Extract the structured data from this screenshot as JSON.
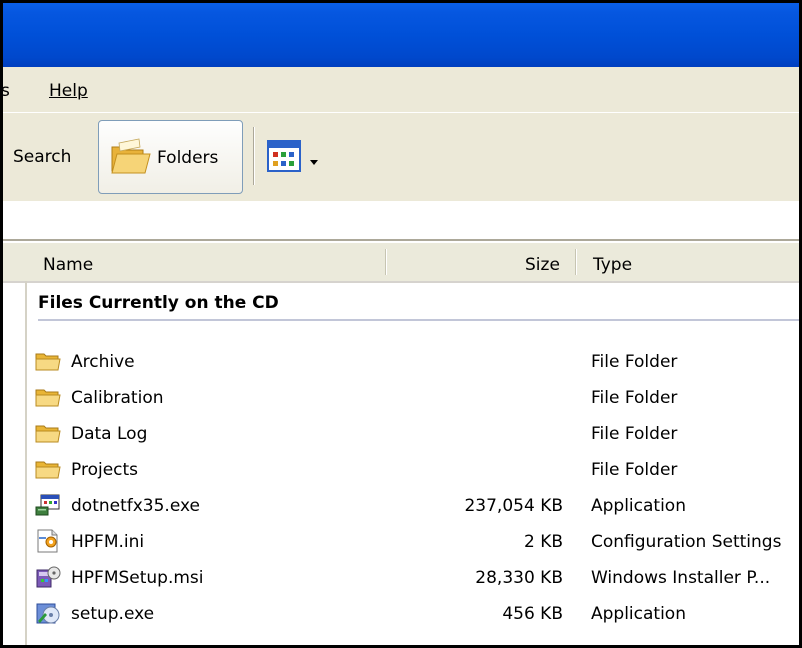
{
  "menu": {
    "partial_item": "s",
    "help_label": "Help"
  },
  "toolbar": {
    "search_label": "Search",
    "folders_label": "Folders"
  },
  "columns": {
    "name": "Name",
    "size": "Size",
    "type": "Type"
  },
  "group_label": "Files Currently on the CD",
  "files": [
    {
      "name": "Archive",
      "size": "",
      "type": "File Folder",
      "icon": "folder-icon"
    },
    {
      "name": "Calibration",
      "size": "",
      "type": "File Folder",
      "icon": "folder-icon"
    },
    {
      "name": "Data Log",
      "size": "",
      "type": "File Folder",
      "icon": "folder-icon"
    },
    {
      "name": "Projects",
      "size": "",
      "type": "File Folder",
      "icon": "folder-icon"
    },
    {
      "name": "dotnetfx35.exe",
      "size": "237,054 KB",
      "type": "Application",
      "icon": "exe-icon"
    },
    {
      "name": "HPFM.ini",
      "size": "2 KB",
      "type": "Configuration Settings",
      "icon": "ini-icon"
    },
    {
      "name": "HPFMSetup.msi",
      "size": "28,330 KB",
      "type": "Windows Installer P...",
      "icon": "msi-icon"
    },
    {
      "name": "setup.exe",
      "size": "456 KB",
      "type": "Application",
      "icon": "setup-icon"
    }
  ],
  "colors": {
    "titlebar": "#0050d8",
    "chrome": "#ece9d8",
    "header": "#ebeadb"
  }
}
